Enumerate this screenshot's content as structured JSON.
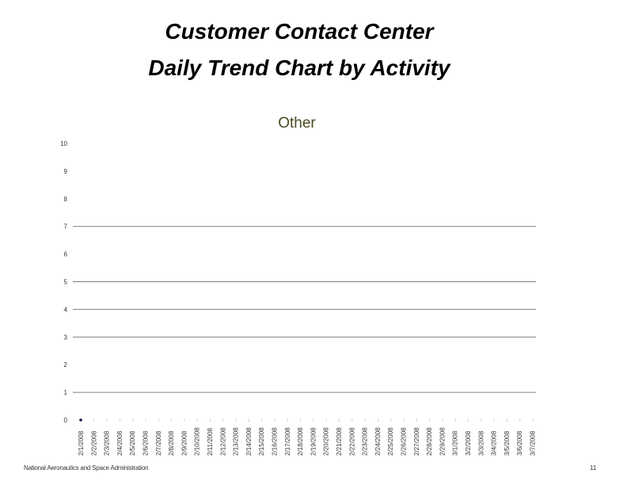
{
  "page": {
    "title_line1": "Customer Contact Center",
    "title_line2": "Daily Trend Chart by Activity",
    "footer_org": "National Aeronautics and Space Administration",
    "page_number": "11"
  },
  "chart_data": {
    "type": "line",
    "title": "Other",
    "xlabel": "",
    "ylabel": "",
    "ylim": [
      0,
      10
    ],
    "yticks": [
      0,
      1,
      2,
      3,
      4,
      5,
      6,
      7,
      8,
      9,
      10
    ],
    "gridlines_at": [
      1,
      3,
      4,
      5,
      7
    ],
    "grid": true,
    "legend": "none",
    "categories": [
      "2/1/2008",
      "2/2/2008",
      "2/3/2008",
      "2/4/2008",
      "2/5/2008",
      "2/6/2008",
      "2/7/2008",
      "2/8/2008",
      "2/9/2008",
      "2/10/2008",
      "2/11/2008",
      "2/12/2008",
      "2/13/2008",
      "2/14/2008",
      "2/15/2008",
      "2/16/2008",
      "2/17/2008",
      "2/18/2008",
      "2/19/2008",
      "2/20/2008",
      "2/21/2008",
      "2/22/2008",
      "2/23/2008",
      "2/24/2008",
      "2/25/2008",
      "2/26/2008",
      "2/27/2008",
      "2/28/2008",
      "2/29/2008",
      "3/1/2008",
      "3/2/2008",
      "3/3/2008",
      "3/4/2008",
      "3/5/2008",
      "3/6/2008",
      "3/7/2008"
    ],
    "series": [
      {
        "name": "Other",
        "values": [
          0,
          null,
          null,
          null,
          null,
          null,
          null,
          null,
          null,
          null,
          null,
          null,
          null,
          null,
          null,
          null,
          null,
          null,
          null,
          null,
          null,
          null,
          null,
          null,
          null,
          null,
          null,
          null,
          null,
          null,
          null,
          null,
          null,
          null,
          null,
          null
        ],
        "color": "#1a1a4a"
      }
    ],
    "colors": {
      "grid": "#808080",
      "subtitle": "#4a4a22",
      "tick_label": "#333333"
    }
  }
}
